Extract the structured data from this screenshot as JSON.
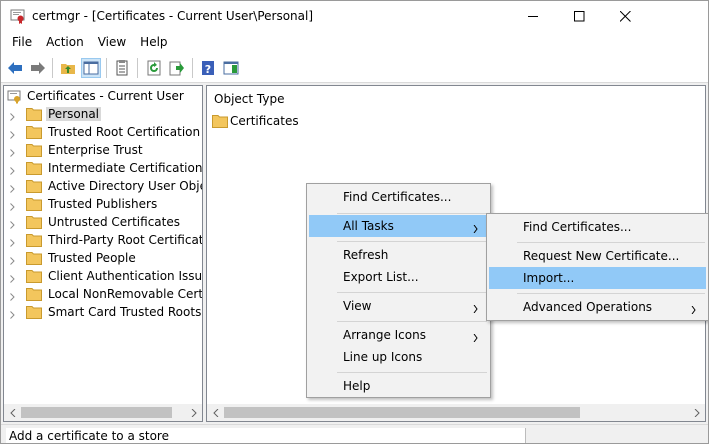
{
  "window": {
    "title": "certmgr - [Certificates - Current User\\Personal]"
  },
  "menubar": {
    "items": [
      "File",
      "Action",
      "View",
      "Help"
    ]
  },
  "toolbar": {
    "buttons": [
      "back-arrow-icon",
      "forward-arrow-icon",
      "up-folder-icon",
      "show-hide-tree-icon",
      "properties-icon",
      "refresh-icon",
      "export-list-icon",
      "help-icon",
      "show-action-pane-icon"
    ]
  },
  "tree": {
    "root": "Certificates - Current User",
    "items": [
      {
        "label": "Personal",
        "selected": true
      },
      {
        "label": "Trusted Root Certification Au"
      },
      {
        "label": "Enterprise Trust"
      },
      {
        "label": "Intermediate Certification Au"
      },
      {
        "label": "Active Directory User Object"
      },
      {
        "label": "Trusted Publishers"
      },
      {
        "label": "Untrusted Certificates"
      },
      {
        "label": "Third-Party Root Certification"
      },
      {
        "label": "Trusted People"
      },
      {
        "label": "Client Authentication Issuers"
      },
      {
        "label": "Local NonRemovable Certific"
      },
      {
        "label": "Smart Card Trusted Roots"
      }
    ]
  },
  "list": {
    "column_header": "Object Type",
    "items": [
      "Certificates"
    ]
  },
  "context_menu": {
    "items": [
      {
        "label": "Find Certificates...",
        "submenu": false
      },
      {
        "label": "All Tasks",
        "submenu": true,
        "highlighted": true
      },
      {
        "label": "Refresh",
        "submenu": false
      },
      {
        "label": "Export List...",
        "submenu": false
      },
      {
        "label": "View",
        "submenu": true
      },
      {
        "label": "Arrange Icons",
        "submenu": true
      },
      {
        "label": "Line up Icons",
        "submenu": false
      },
      {
        "label": "Help",
        "submenu": false
      }
    ]
  },
  "submenu": {
    "items": [
      {
        "label": "Find Certificates...",
        "submenu": false
      },
      {
        "label": "Request New Certificate...",
        "submenu": false
      },
      {
        "label": "Import...",
        "submenu": false,
        "highlighted": true
      },
      {
        "label": "Advanced Operations",
        "submenu": true
      }
    ]
  },
  "statusbar": {
    "text": "Add a certificate to a store"
  },
  "colors": {
    "highlight": "#91c9f7",
    "selection": "#d9d9d9",
    "folder": "#f3c65d",
    "toolbar_blue": "#2d6fbf"
  }
}
